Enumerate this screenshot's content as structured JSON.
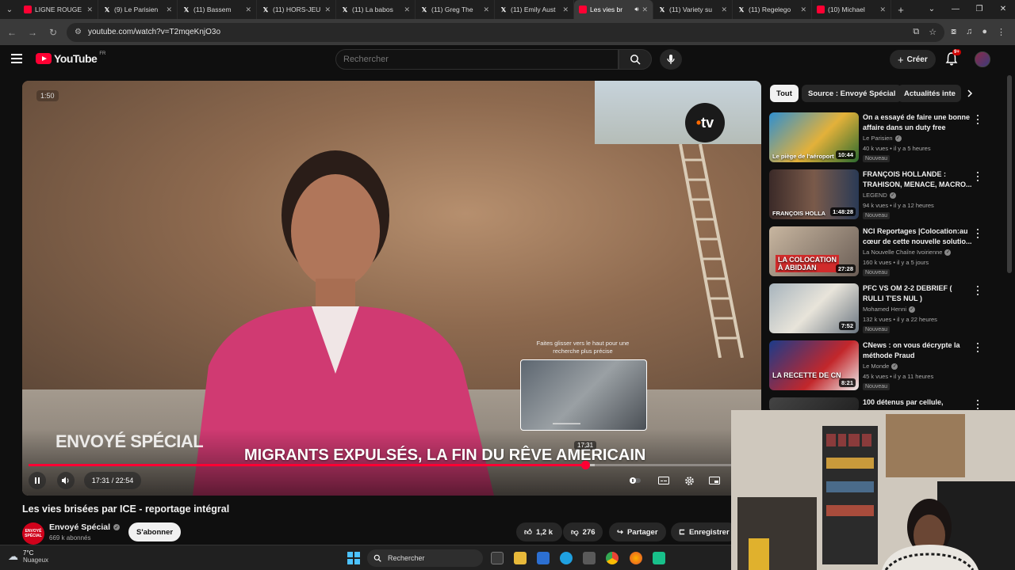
{
  "browser": {
    "tabs": [
      {
        "icon": "youtube-favicon",
        "title": "LIGNE ROUGE",
        "active": false
      },
      {
        "icon": "x-favicon",
        "title": "(9) Le Parisien",
        "active": false
      },
      {
        "icon": "x-favicon",
        "title": "(11) Bassem",
        "active": false
      },
      {
        "icon": "x-favicon",
        "title": "(11) HORS-JEU",
        "active": false
      },
      {
        "icon": "x-favicon",
        "title": "(11) La babos",
        "active": false
      },
      {
        "icon": "x-favicon",
        "title": "(11) Greg The",
        "active": false
      },
      {
        "icon": "x-favicon",
        "title": "(11) Emily Aust",
        "active": false
      },
      {
        "icon": "youtube-favicon",
        "title": "Les vies br",
        "active": true
      },
      {
        "icon": "x-favicon",
        "title": "(11) Variety su",
        "active": false
      },
      {
        "icon": "x-favicon",
        "title": "(11) Regelego",
        "active": false
      },
      {
        "icon": "youtube-favicon",
        "title": "(10) Michael",
        "active": false
      }
    ],
    "url": "youtube.com/watch?v=T2mqeKnjO3o"
  },
  "youtube": {
    "logo_text": "YouTube",
    "region": "FR",
    "search_placeholder": "Rechercher",
    "create_label": "Créer",
    "notif_badge": "9+"
  },
  "player": {
    "corner_time": "1:50",
    "channel_bug": "tv",
    "show_brand": "ENVOYÉ SPÉCIAL",
    "lower_third": "MIGRANTS EXPULSÉS, LA FIN DU RÊVE AMÉRICAIN",
    "preview_hint": "Faites glisser vers le haut pour une recherche plus précise",
    "preview_time": "17:31",
    "time_display": "17:31 / 22:54",
    "progress": 0.766,
    "buffered": 0.78
  },
  "video": {
    "title": "Les vies brisées par ICE - reportage intégral",
    "channel": "Envoyé Spécial",
    "channel_avatar_text": "ENVOYÉ SPÉCIAL",
    "subscribers": "669 k abonnés",
    "subscribe_label": "S'abonner",
    "likes": "1,2 k",
    "dislikes": "276",
    "share_label": "Partager",
    "save_label": "Enregistrer"
  },
  "chips": [
    {
      "label": "Tout",
      "active": true
    },
    {
      "label": "Source : Envoyé Spécial",
      "active": false
    },
    {
      "label": "Actualités inte",
      "active": false
    }
  ],
  "recommendations": [
    {
      "title": "On a essayé de faire une bonne affaire dans un duty free",
      "channel": "Le Parisien",
      "meta": "40 k vues • il y a 5 heures",
      "badge": "Nouveau",
      "duration": "10:44",
      "thumb_text": "Le piège de l'aéroport"
    },
    {
      "title": "FRANÇOIS HOLLANDE : TRAHISON, MENACE, MACRO...",
      "channel": "LEGEND",
      "meta": "94 k vues • il y a 12 heures",
      "badge": "Nouveau",
      "duration": "1:48:28",
      "thumb_text": "FRANÇOIS HOLLA"
    },
    {
      "title": "NCI Reportages |Colocation:au cœur de cette nouvelle solutio...",
      "channel": "La Nouvelle Chaîne Ivoirienne",
      "meta": "160 k vues • il y a 5 jours",
      "badge": "Nouveau",
      "duration": "27:28",
      "thumb_text": "LA COLOCATION À ABIDJAN"
    },
    {
      "title": "PFC VS OM 2-2 DEBRIEF ( RULLI T'ES NUL )",
      "channel": "Mohamed Henni",
      "meta": "132 k vues • il y a 22 heures",
      "badge": "Nouveau",
      "duration": "7:52",
      "thumb_text": ""
    },
    {
      "title": "CNews : on vous décrypte la méthode Praud",
      "channel": "Le Monde",
      "meta": "45 k vues • il y a 11 heures",
      "badge": "Nouveau",
      "duration": "8:21",
      "thumb_text": "LA RECETTE DE CN"
    },
    {
      "title": "100 détenus par cellule,",
      "channel": "",
      "meta": "",
      "badge": "",
      "duration": "",
      "thumb_text": ""
    }
  ],
  "taskbar": {
    "temperature": "7°C",
    "weather": "Nuageux",
    "search_label": "Rechercher"
  },
  "colors": {
    "accent": "#ff0033",
    "background": "#0f0f0f",
    "pill": "#272727"
  }
}
